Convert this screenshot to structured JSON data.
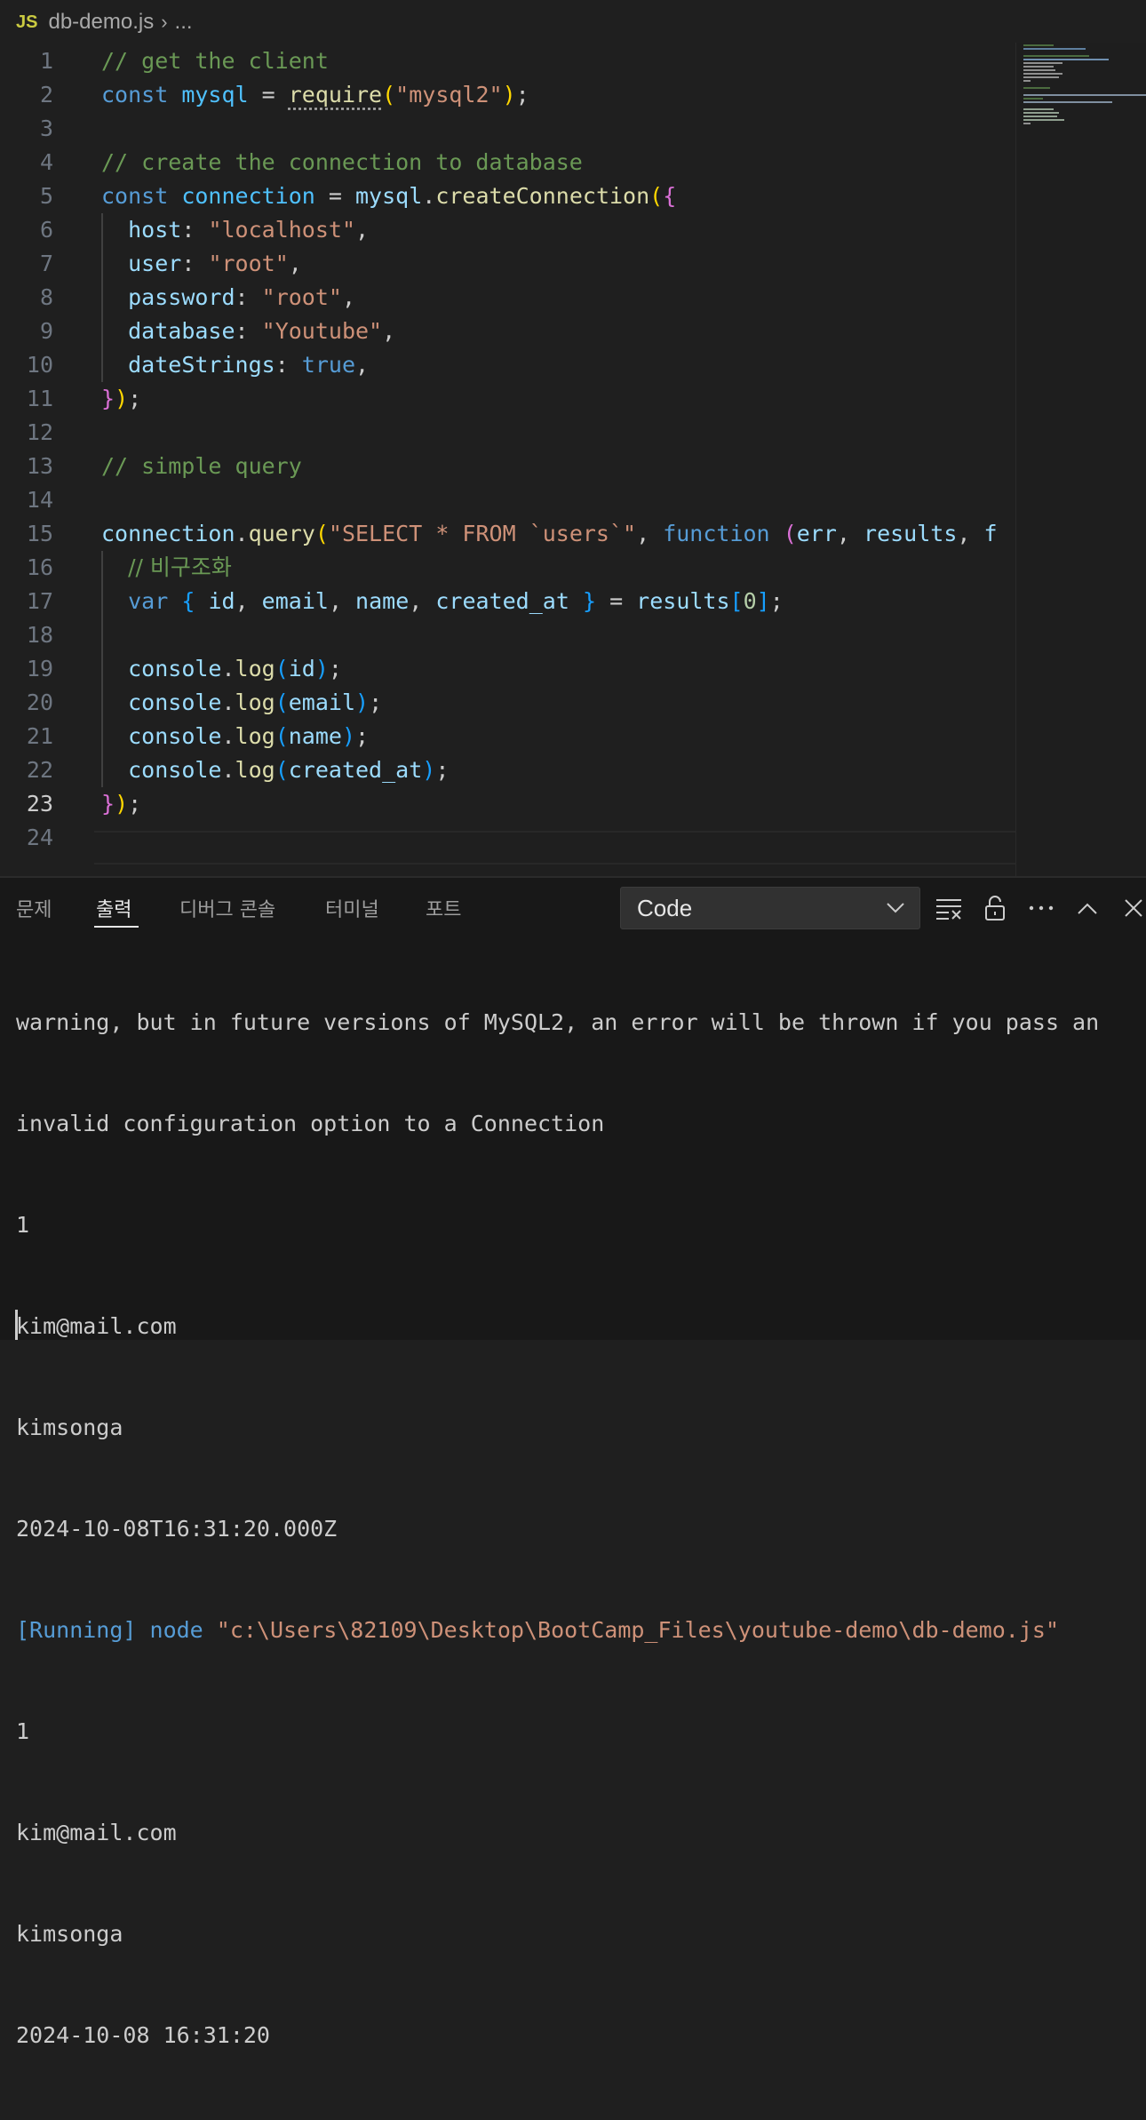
{
  "breadcrumb": {
    "badge": "JS",
    "file": "db-demo.js",
    "more": "..."
  },
  "editor": {
    "active_line": 23,
    "lines": [
      {
        "n": "1"
      },
      {
        "n": "2"
      },
      {
        "n": "3"
      },
      {
        "n": "4"
      },
      {
        "n": "5"
      },
      {
        "n": "6"
      },
      {
        "n": "7"
      },
      {
        "n": "8"
      },
      {
        "n": "9"
      },
      {
        "n": "10"
      },
      {
        "n": "11"
      },
      {
        "n": "12"
      },
      {
        "n": "13"
      },
      {
        "n": "14"
      },
      {
        "n": "15"
      },
      {
        "n": "16"
      },
      {
        "n": "17"
      },
      {
        "n": "18"
      },
      {
        "n": "19"
      },
      {
        "n": "20"
      },
      {
        "n": "21"
      },
      {
        "n": "22"
      },
      {
        "n": "23"
      },
      {
        "n": "24"
      }
    ],
    "code": {
      "l1_comment": "// get the client",
      "l2_const": "const",
      "l2_var": "mysql",
      "l2_eq": " = ",
      "l2_fn": "require",
      "l2_str": "\"mysql2\"",
      "l2_end": ";",
      "l4_comment": "// create the connection to database",
      "l5_const": "const",
      "l5_var": "connection",
      "l5_eq": " = ",
      "l5_obj": "mysql",
      "l5_dot": ".",
      "l5_fn": "createConnection",
      "l6_key": "host",
      "l6_val": "\"localhost\"",
      "l7_key": "user",
      "l7_val": "\"root\"",
      "l8_key": "password",
      "l8_val": "\"root\"",
      "l9_key": "database",
      "l9_val": "\"Youtube\"",
      "l10_key": "dateStrings",
      "l10_val": "true",
      "l13_comment": "// simple query",
      "l15_obj": "connection",
      "l15_fn": "query",
      "l15_str": "\"SELECT * FROM `users`\"",
      "l15_kw": "function",
      "l15_p1": "err",
      "l15_p2": "results",
      "l15_p3": "f",
      "l16_comment": "// 비구조화",
      "l17_kw": "var",
      "l17_a": "id",
      "l17_b": "email",
      "l17_c": "name",
      "l17_d": "created_at",
      "l17_res": "results",
      "l17_idx": "0",
      "log_obj": "console",
      "log_fn": "log",
      "l19_arg": "id",
      "l20_arg": "email",
      "l21_arg": "name",
      "l22_arg": "created_at"
    }
  },
  "panel": {
    "tabs": [
      "문제",
      "출력",
      "디버그 콘솔",
      "터미널",
      "포트"
    ],
    "active_tab": "출력",
    "channel_select": "Code",
    "icons": [
      "clear-output-icon",
      "lock-icon",
      "more-icon",
      "maximize-icon",
      "close-icon"
    ],
    "output": [
      "warning, but in future versions of MySQL2, an error will be thrown if you pass an",
      "invalid configuration option to a Connection",
      "1",
      "kim@mail.com",
      "kimsonga",
      "2024-10-08T16:31:20.000Z",
      "1",
      "kim@mail.com",
      "kimsonga",
      "2024-10-08 16:31:20"
    ],
    "run_tag": "[Running]",
    "run_cmd": " node ",
    "run_path": "\"c:\\Users\\82109\\Desktop\\BootCamp_Files\\youtube-demo\\db-demo.js\""
  }
}
